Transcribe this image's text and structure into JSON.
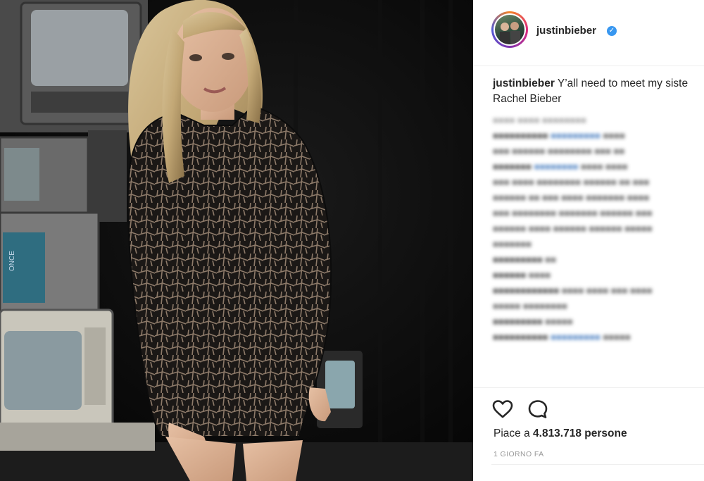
{
  "post": {
    "username": "justinbieber",
    "verified_icon": "verified-badge-icon",
    "caption_user": "justinbieber",
    "caption_text": "Y’all need to meet my siste",
    "caption_text_2": "Rachel Bieber",
    "likes_prefix": "Piace a",
    "likes_count": "4.813.718",
    "likes_suffix": "persone",
    "time_ago": "1 GIORNO FA"
  },
  "colors": {
    "accent": "#3897f0",
    "text": "#262626",
    "muted": "#999999",
    "story_ring": [
      "#f58529",
      "#dd2a7b",
      "#8134af",
      "#515bd4"
    ]
  },
  "icons": {
    "like": "heart-outline-icon",
    "comment": "comment-bubble-icon",
    "verified": "check-badge-icon"
  }
}
